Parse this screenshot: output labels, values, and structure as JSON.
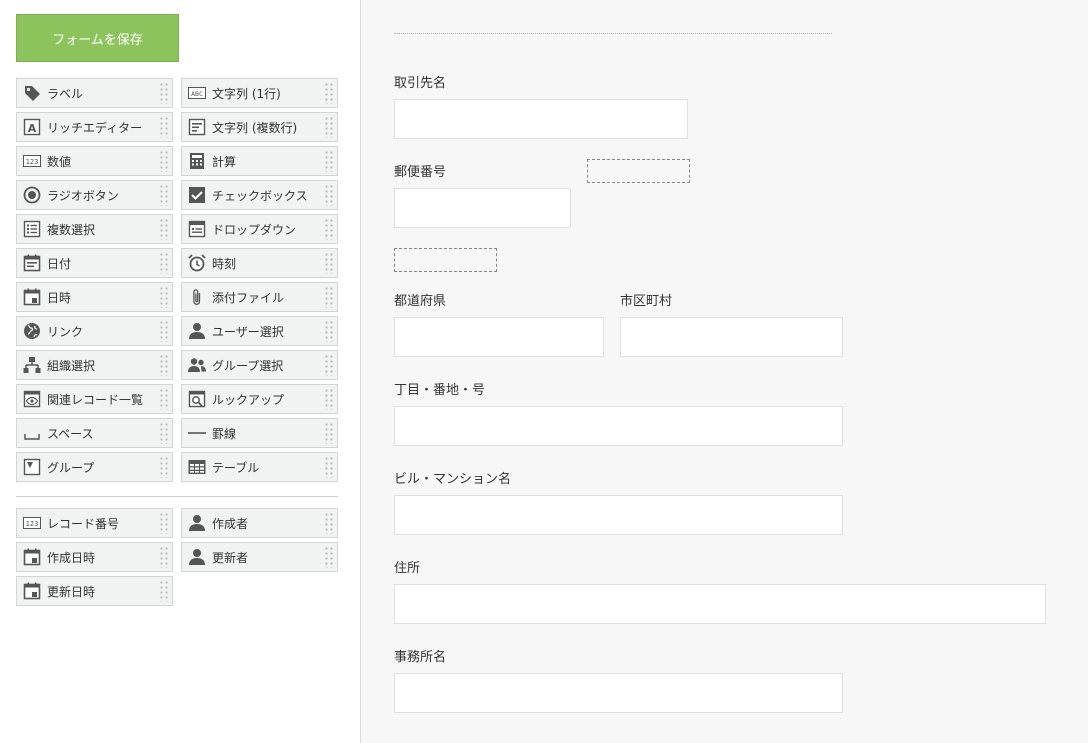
{
  "sidebar": {
    "save_button": "フォームを保存",
    "palette": [
      {
        "label": "ラベル",
        "icon": "tag-icon"
      },
      {
        "label": "文字列 (1行)",
        "icon": "abc-text-icon"
      },
      {
        "label": "リッチエディター",
        "icon": "rich-editor-icon"
      },
      {
        "label": "文字列 (複数行)",
        "icon": "multiline-text-icon"
      },
      {
        "label": "数値",
        "icon": "number-icon"
      },
      {
        "label": "計算",
        "icon": "calculator-icon"
      },
      {
        "label": "ラジオボタン",
        "icon": "radio-button-icon"
      },
      {
        "label": "チェックボックス",
        "icon": "checkbox-icon"
      },
      {
        "label": "複数選択",
        "icon": "multi-select-icon"
      },
      {
        "label": "ドロップダウン",
        "icon": "dropdown-icon"
      },
      {
        "label": "日付",
        "icon": "date-icon"
      },
      {
        "label": "時刻",
        "icon": "alarm-clock-icon"
      },
      {
        "label": "日時",
        "icon": "datetime-icon"
      },
      {
        "label": "添付ファイル",
        "icon": "paperclip-icon"
      },
      {
        "label": "リンク",
        "icon": "globe-icon"
      },
      {
        "label": "ユーザー選択",
        "icon": "user-icon"
      },
      {
        "label": "組織選択",
        "icon": "organization-icon"
      },
      {
        "label": "グループ選択",
        "icon": "group-icon"
      },
      {
        "label": "関連レコード一覧",
        "icon": "related-records-icon"
      },
      {
        "label": "ルックアップ",
        "icon": "lookup-icon"
      },
      {
        "label": "スペース",
        "icon": "space-icon"
      },
      {
        "label": "罫線",
        "icon": "horizontal-line-icon"
      },
      {
        "label": "グループ",
        "icon": "group-field-icon"
      },
      {
        "label": "テーブル",
        "icon": "table-icon"
      }
    ],
    "system_fields": [
      {
        "label": "レコード番号",
        "icon": "number-icon"
      },
      {
        "label": "作成者",
        "icon": "user-icon"
      },
      {
        "label": "作成日時",
        "icon": "datetime-icon"
      },
      {
        "label": "更新者",
        "icon": "user-icon"
      },
      {
        "label": "更新日時",
        "icon": "datetime-icon"
      }
    ]
  },
  "form": {
    "fields": [
      {
        "label": "取引先名",
        "value": ""
      },
      {
        "label": "郵便番号",
        "value": ""
      },
      {
        "label": "都道府県",
        "value": ""
      },
      {
        "label": "市区町村",
        "value": ""
      },
      {
        "label": "丁目・番地・号",
        "value": ""
      },
      {
        "label": "ビル・マンション名",
        "value": ""
      },
      {
        "label": "住所",
        "value": ""
      },
      {
        "label": "事務所名",
        "value": ""
      }
    ]
  },
  "colors": {
    "save_button": "#8cc35c",
    "canvas_background": "#f7f7f7",
    "palette_item": "#f1f2f2",
    "icon": "#555555"
  }
}
